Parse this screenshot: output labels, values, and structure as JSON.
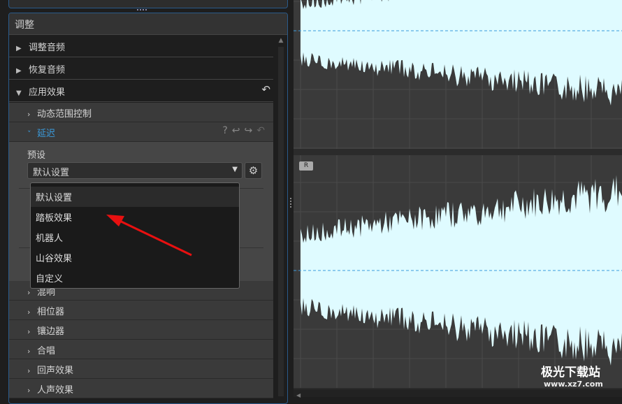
{
  "panel": {
    "title": "调整"
  },
  "sections": [
    {
      "label": "调整音频"
    },
    {
      "label": "恢复音频"
    },
    {
      "label": "应用效果"
    }
  ],
  "effects_top": [
    "动态范围控制"
  ],
  "delay": {
    "label": "延迟",
    "help": "?",
    "preset_label": "预设",
    "preset_value": "默认设置"
  },
  "dropdown": [
    "默认设置",
    "踏板效果",
    "机器人",
    "山谷效果",
    "自定义"
  ],
  "effects_bottom": [
    "混响",
    "相位器",
    "镶边器",
    "合唱",
    "回声效果",
    "人声效果"
  ],
  "channel_badge": "R",
  "watermark": {
    "name": "极光下载站",
    "url": "www.xz7.com"
  },
  "colors": {
    "wave": "#dffbff",
    "accent": "#3a9bdc",
    "arrow": "#e81010"
  }
}
